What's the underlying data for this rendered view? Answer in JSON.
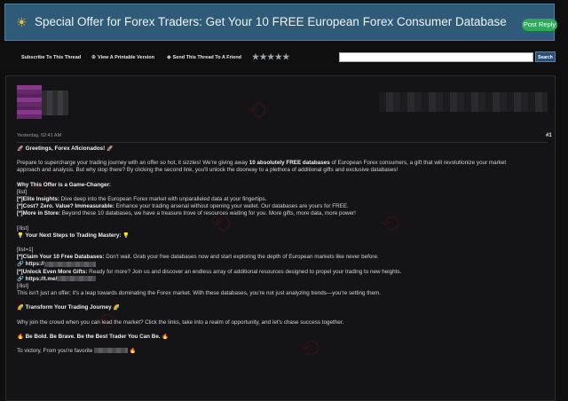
{
  "header": {
    "title": "Special Offer for Forex Traders: Get Your 10 FREE European Forex Consumer Database",
    "post_reply": "Post Reply"
  },
  "toolbar": {
    "subscribe": "Subscribe To This Thread",
    "printable": "View A Printable Version",
    "send": "Send This Thread To A Friend",
    "stars": "★★★★★",
    "search_button": "Search",
    "search_value": ""
  },
  "post": {
    "date": "Yesterday, 02:41 AM",
    "number": "#1",
    "lines": {
      "greet": "Greetings, Forex Aficionados!",
      "p1a": "Prepare to supercharge your trading journey with an offer so hot, it sizzles! We're giving away ",
      "p1b": "10 absolutely FREE databases",
      "p1c": " of European Forex consumers, a gift that will revolutionize your market",
      "p1d": "approach and analysis. But why stop there? By clicking the second link, you'll unlock the doorway to a plethora of additional gifts and exclusive databases!",
      "why": "Why This Offer is a Game-Changer:",
      "list1": "[list]",
      "elite_b": "[*]Elite Insights:",
      "elite": " Dive deep into the European Forex market with unparalleled data at your fingertips.",
      "cost_b": "[*]Cost? Zero. Value? Immeasurable:",
      "cost": " Enhance your trading arsenal without opening your wallet. Our databases are yours for FREE.",
      "more_b": "[*]More in Store:",
      "more": " Beyond these 10 databases, we have a treasure trove of resources waiting for you. More gifts, more data, more power!",
      "endlist1": "[/list]",
      "next": "Your Next Steps to Trading Mastery:",
      "list2": "[list=1]",
      "claim_b": "[*]Claim Your 10 Free Databases:",
      "claim": " Don't wait. Grab your free databases now and start exploring the depth of European markets like never before.",
      "link1": "https://",
      "unlock_b": "[*]Unlock Even More Gifts:",
      "unlock": " Ready for more? Join us and discover an endless array of additional resources designed to propel your trading to new heights.",
      "link2": "https://t.me/",
      "endlist2": "[/list]",
      "leap": "This isn't just an offer; it's a leap towards dominating the Forex market. With these databases, you're not just analyzing trends—you're setting them.",
      "transform": "Transform Your Trading Journey",
      "why2": "Why join the crowd when you can lead the market? Click the links, take into a realm of opportunity, and let's chase success together.",
      "bold": "Be Bold. Be Brave. Be the Best Trader You Can Be.",
      "victory": "To victory, From you're favorite"
    }
  }
}
